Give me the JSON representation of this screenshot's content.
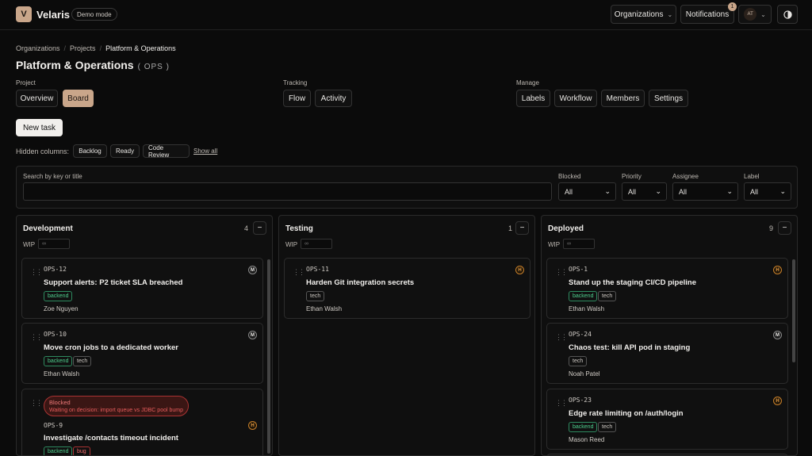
{
  "app": {
    "logo_letter": "V",
    "brand": "Velaris",
    "mode_badge": "Demo mode",
    "org_button": "Organizations",
    "notifications_button": "Notifications",
    "notifications_count": "1",
    "user_initials": "AT",
    "accent_color": "#c9a68a"
  },
  "breadcrumb": [
    "Organizations",
    "Projects",
    "Platform & Operations"
  ],
  "project": {
    "title": "Platform & Operations",
    "code": "( OPS )"
  },
  "nav": {
    "project_label": "Project",
    "project_items": [
      "Overview",
      "Board"
    ],
    "active": "Board",
    "tracking_label": "Tracking",
    "tracking_items": [
      "Flow",
      "Activity"
    ],
    "manage_label": "Manage",
    "manage_items": [
      "Labels",
      "Workflow",
      "Members",
      "Settings"
    ]
  },
  "new_task_button": "New task",
  "hidden_columns": {
    "label": "Hidden columns:",
    "items": [
      "Backlog",
      "Ready",
      "Code Review"
    ],
    "show_all": "Show all"
  },
  "filters": {
    "search_label": "Search by key or title",
    "search_value": "",
    "blocked_label": "Blocked",
    "blocked_value": "All",
    "priority_label": "Priority",
    "priority_value": "All",
    "assignee_label": "Assignee",
    "assignee_value": "All",
    "label_label": "Label",
    "label_value": "All"
  },
  "columns": [
    {
      "title": "Development",
      "count": "4",
      "wip_label": "WIP",
      "wip_placeholder": "∞",
      "cards": [
        {
          "key": "OPS-12",
          "title": "Support alerts: P2 ticket SLA breached",
          "tags": [
            "backend"
          ],
          "assignee": "Zoe Nguyen",
          "priority": "M"
        },
        {
          "key": "OPS-10",
          "title": "Move cron jobs to a dedicated worker",
          "tags": [
            "backend",
            "tech"
          ],
          "assignee": "Ethan Walsh",
          "priority": "M"
        },
        {
          "key": "OPS-9",
          "title": "Investigate /contacts timeout incident",
          "tags": [
            "backend",
            "bug"
          ],
          "assignee": "",
          "priority": "H",
          "blocked": "Blocked",
          "blocked_reason": "Waiting on decision: import queue vs JDBC pool bump"
        }
      ]
    },
    {
      "title": "Testing",
      "count": "1",
      "wip_label": "WIP",
      "wip_placeholder": "∞",
      "cards": [
        {
          "key": "OPS-11",
          "title": "Harden Git integration secrets",
          "tags": [
            "tech"
          ],
          "assignee": "Ethan Walsh",
          "priority": "H"
        }
      ]
    },
    {
      "title": "Deployed",
      "count": "9",
      "wip_label": "WIP",
      "wip_placeholder": "∞",
      "cards": [
        {
          "key": "OPS-1",
          "title": "Stand up the staging CI/CD pipeline",
          "tags": [
            "backend",
            "tech"
          ],
          "assignee": "Ethan Walsh",
          "priority": "H"
        },
        {
          "key": "OPS-24",
          "title": "Chaos test: kill API pod in staging",
          "tags": [
            "tech"
          ],
          "assignee": "Noah Patel",
          "priority": "M"
        },
        {
          "key": "OPS-23",
          "title": "Edge rate limiting on /auth/login",
          "tags": [
            "backend",
            "tech"
          ],
          "assignee": "Mason Reed",
          "priority": "H"
        }
      ]
    }
  ]
}
